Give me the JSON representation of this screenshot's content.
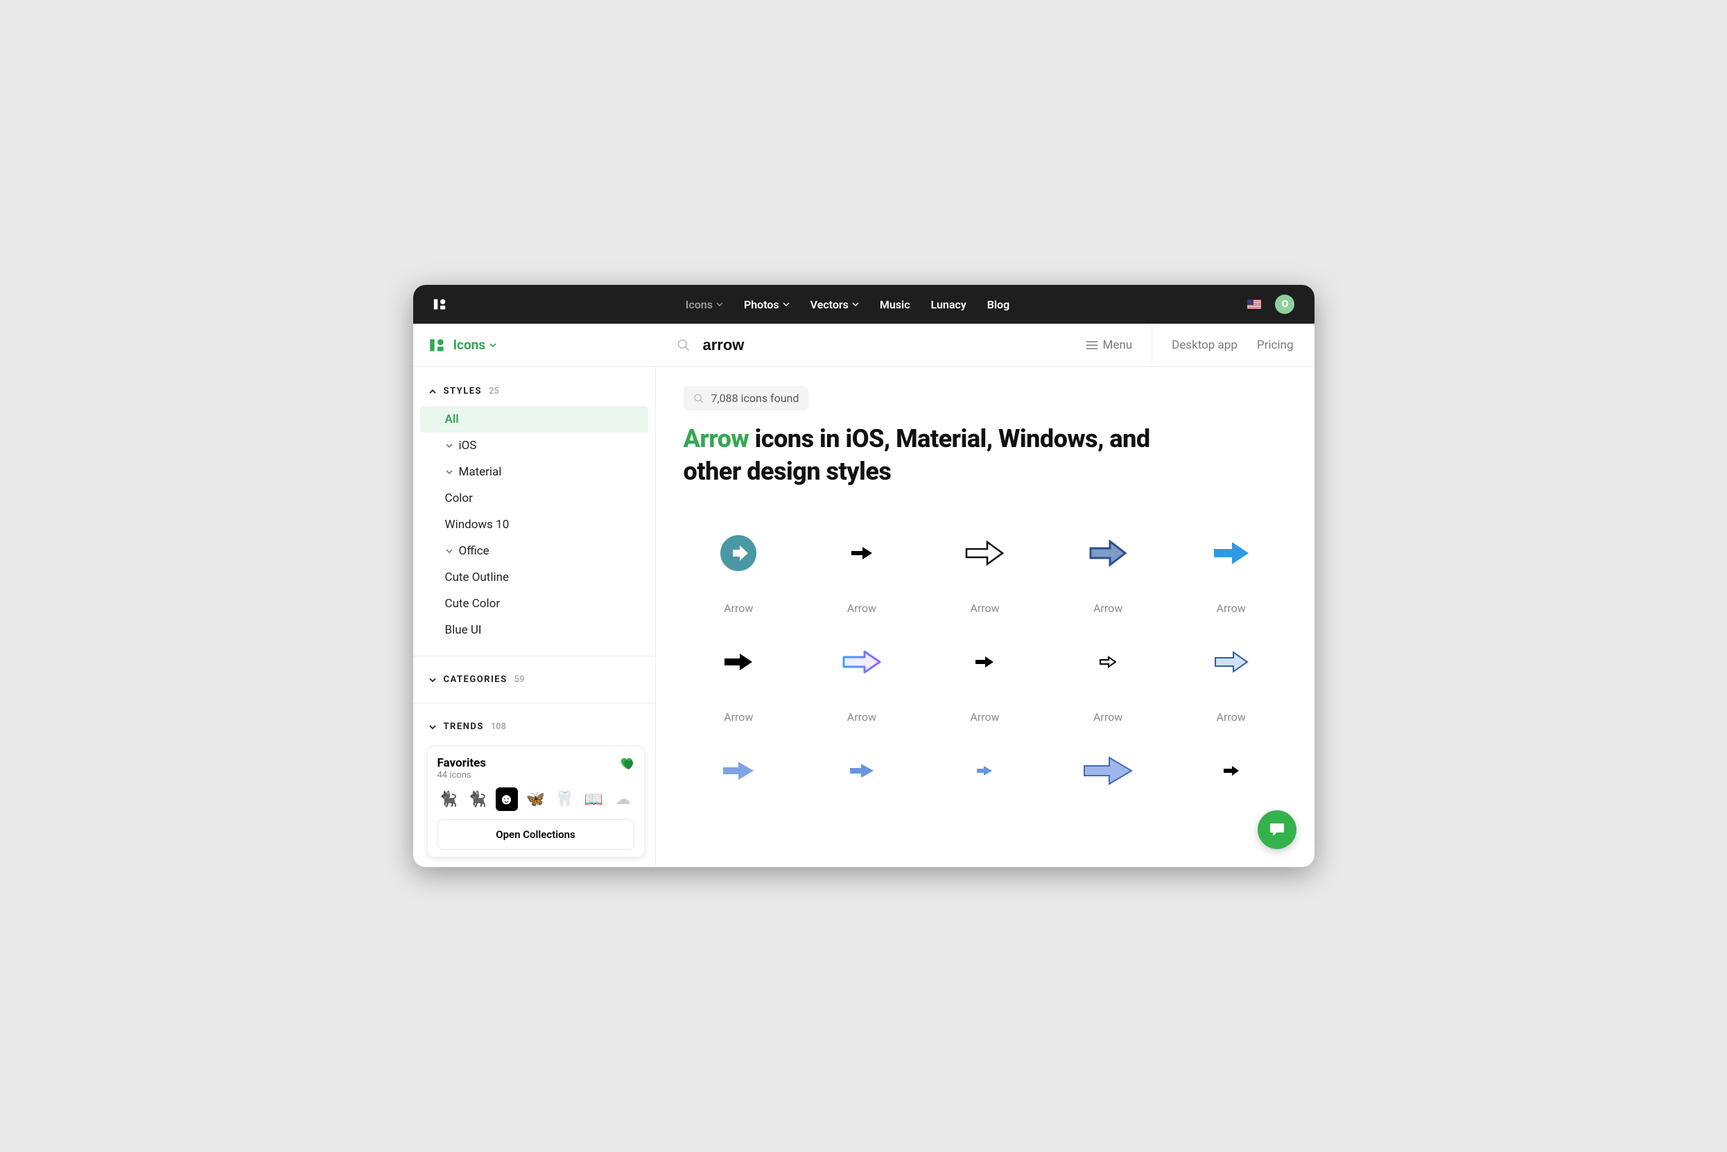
{
  "top": {
    "nav": {
      "icons": "Icons",
      "photos": "Photos",
      "vectors": "Vectors",
      "music": "Music",
      "lunacy": "Lunacy",
      "blog": "Blog"
    },
    "avatar_initial": "O"
  },
  "second": {
    "brand": "Icons",
    "search_value": "arrow",
    "menu": "Menu",
    "desktop": "Desktop app",
    "pricing": "Pricing"
  },
  "sidebar": {
    "styles_label": "STYLES",
    "styles_count": "25",
    "items": [
      {
        "label": "All",
        "active": true
      },
      {
        "label": "iOS",
        "expandable": true
      },
      {
        "label": "Material",
        "expandable": true
      },
      {
        "label": "Color"
      },
      {
        "label": "Windows 10"
      },
      {
        "label": "Office",
        "expandable": true
      },
      {
        "label": "Cute Outline"
      },
      {
        "label": "Cute Color"
      },
      {
        "label": "Blue UI"
      }
    ],
    "categories_label": "CATEGORIES",
    "categories_count": "59",
    "trends_label": "TRENDS",
    "trends_count": "108"
  },
  "favorites": {
    "title": "Favorites",
    "subtitle": "44 icons",
    "open": "Open Collections"
  },
  "results": {
    "count_text": "7,088 icons found",
    "title_keyword": "Arrow",
    "title_rest": " icons in iOS, Material, Windows, and other design styles",
    "tiles": [
      {
        "label": "Arrow"
      },
      {
        "label": "Arrow"
      },
      {
        "label": "Arrow"
      },
      {
        "label": "Arrow"
      },
      {
        "label": "Arrow"
      },
      {
        "label": "Arrow"
      },
      {
        "label": "Arrow"
      },
      {
        "label": "Arrow"
      },
      {
        "label": "Arrow"
      },
      {
        "label": "Arrow"
      },
      {
        "label": ""
      },
      {
        "label": ""
      },
      {
        "label": ""
      },
      {
        "label": ""
      },
      {
        "label": ""
      }
    ]
  }
}
